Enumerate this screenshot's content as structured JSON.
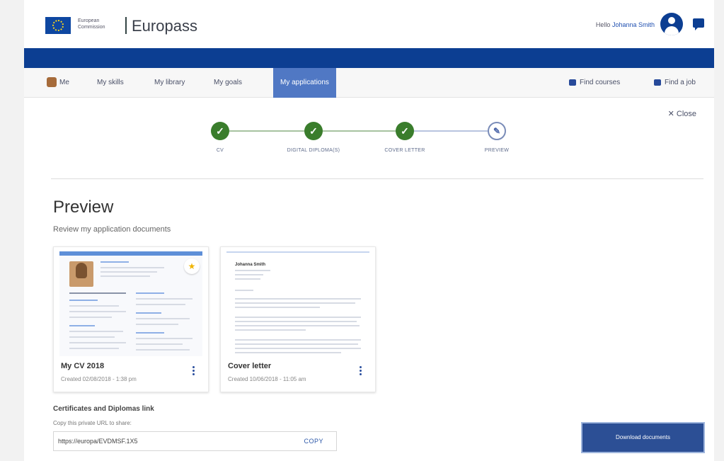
{
  "header": {
    "org_line1": "European",
    "org_line2": "Commission",
    "brand": "Europass",
    "hello_prefix": "Hello",
    "user_name": "Johanna Smith"
  },
  "nav": {
    "items": [
      {
        "label": "Me"
      },
      {
        "label": "My skills"
      },
      {
        "label": "My library"
      },
      {
        "label": "My goals"
      },
      {
        "label": "My applications"
      }
    ],
    "find_courses": "Find courses",
    "find_job": "Find a job"
  },
  "close_label": "Close",
  "stepper": {
    "steps": [
      {
        "label": "CV",
        "status": "done"
      },
      {
        "label": "DIGITAL DIPLOMA(S)",
        "status": "done"
      },
      {
        "label": "COVER LETTER",
        "status": "done"
      },
      {
        "label": "PREVIEW",
        "status": "current"
      }
    ],
    "colors": {
      "done": "#3a7d2c",
      "current": "#7a8cb8"
    }
  },
  "title": "Preview",
  "subtitle": "Review my application documents",
  "documents": [
    {
      "title": "My CV 2018",
      "date": "Created 02/08/2018 - 1:38 pm",
      "thumb_name": "Johanna Smith"
    },
    {
      "title": "Cover letter",
      "date": "Created 10/06/2018 - 11:05 am",
      "thumb_name": "Johanna Smith"
    }
  ],
  "certificates": {
    "title": "Certificates and Diplomas link",
    "hint": "Copy this private URL to share:",
    "url": "https://europa/EVDMSF.1X5",
    "copy_label": "COPY"
  },
  "download_label": "Download documents",
  "colors": {
    "brand_blue": "#0c3e92",
    "active_tab": "#5078c4",
    "success": "#3a7d2c"
  }
}
